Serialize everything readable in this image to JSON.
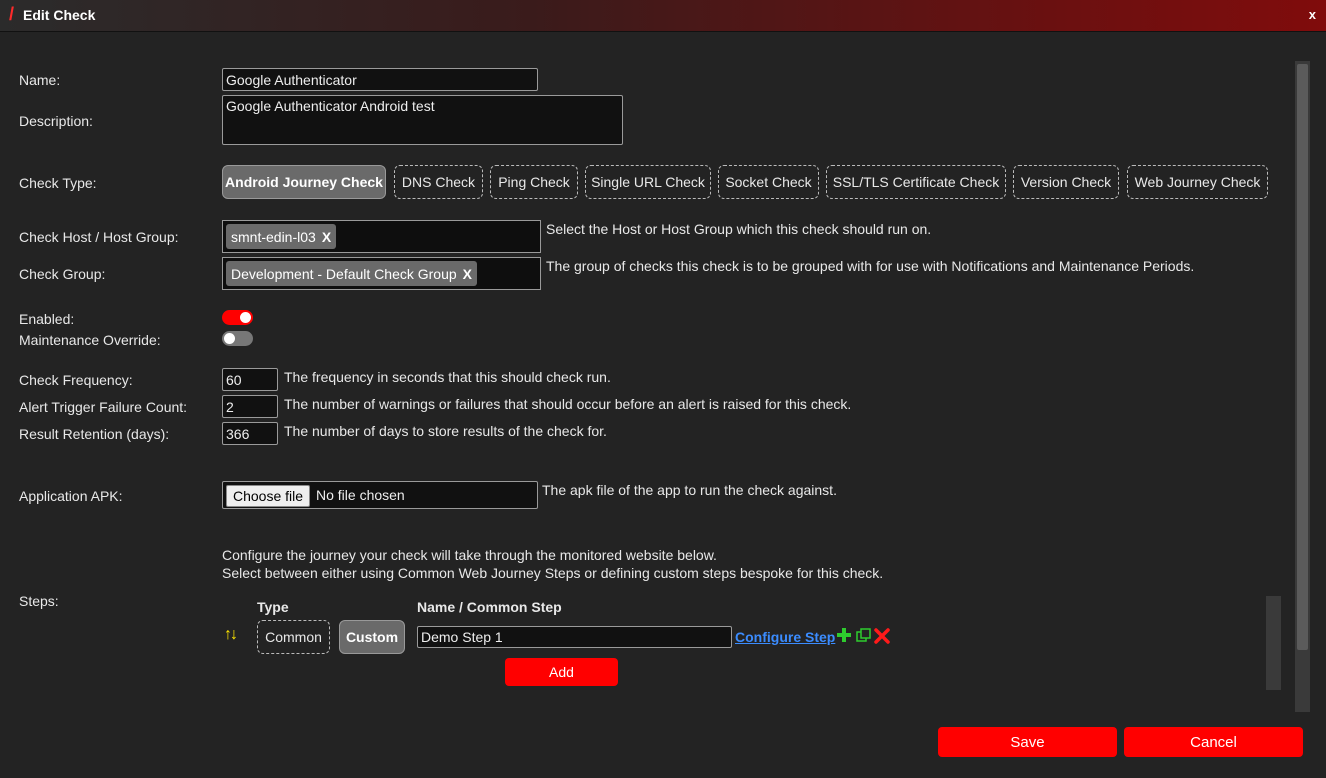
{
  "window": {
    "title": "Edit Check",
    "close": "x"
  },
  "fields": {
    "name_label": "Name:",
    "name_value": "Google Authenticator",
    "description_label": "Description:",
    "description_value": "Google Authenticator Android test",
    "check_type_label": "Check Type:",
    "host_label": "Check Host / Host Group:",
    "host_tag": "smnt-edin-l03",
    "host_help": "Select the Host or Host Group which this check should run on.",
    "group_label": "Check Group:",
    "group_tag": "Development - Default Check Group",
    "group_help": "The group of checks this check is to be grouped with for use with Notifications and Maintenance Periods.",
    "tag_remove": "X",
    "enabled_label": "Enabled:",
    "enabled": true,
    "maint_label": "Maintenance Override:",
    "maint": false,
    "freq_label": "Check Frequency:",
    "freq_value": "60",
    "freq_help": "The frequency in seconds that this should check run.",
    "alert_label": "Alert Trigger Failure Count:",
    "alert_value": "2",
    "alert_help": "The number of warnings or failures that should occur before an alert is raised for this check.",
    "retention_label": "Result Retention (days):",
    "retention_value": "366",
    "retention_help": "The number of days to store results of the check for.",
    "apk_label": "Application APK:",
    "apk_button": "Choose file",
    "apk_status": "No file chosen",
    "apk_help": "The apk file of the app to run the check against."
  },
  "check_types": [
    "Android Journey Check",
    "DNS Check",
    "Ping Check",
    "Single URL Check",
    "Socket Check",
    "SSL/TLS Certificate Check",
    "Version Check",
    "Web Journey Check"
  ],
  "steps": {
    "label": "Steps:",
    "intro_line1": "Configure the journey your check will take through the monitored website below.",
    "intro_line2": "Select between either using Common Web Journey Steps or defining custom steps bespoke for this check.",
    "type_header": "Type",
    "name_header": "Name / Common Step",
    "common_label": "Common",
    "custom_label": "Custom",
    "step_name": "Demo Step 1",
    "configure_link": "Configure Step",
    "add_button": "Add"
  },
  "footer": {
    "save": "Save",
    "cancel": "Cancel"
  },
  "colors": {
    "accent_red": "#ff0000",
    "link_blue": "#3b8cff",
    "add_green": "#2ecc2e",
    "arrow_yellow": "#ffe600"
  }
}
